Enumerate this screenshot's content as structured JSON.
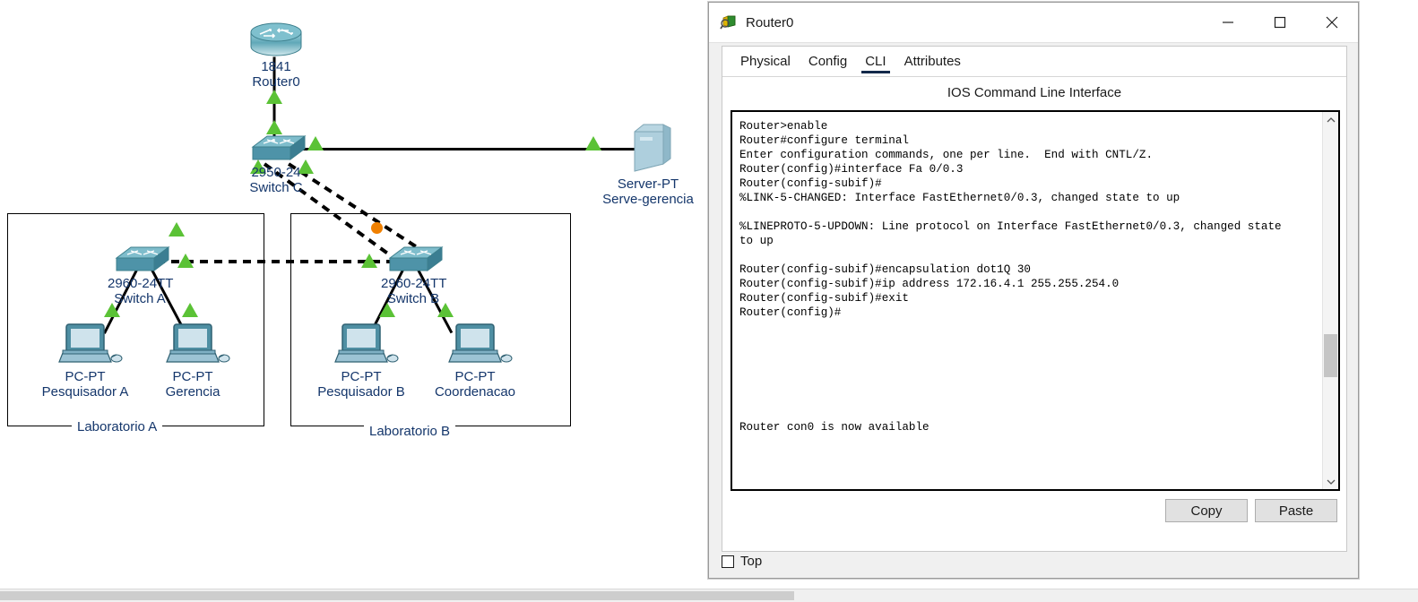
{
  "window": {
    "title": "Router0",
    "icon": "packet-tracer-device-icon",
    "controls": {
      "minimize": "minimize-icon",
      "maximize": "maximize-icon",
      "close": "close-icon"
    }
  },
  "tabs": [
    {
      "label": "Physical",
      "active": false
    },
    {
      "label": "Config",
      "active": false
    },
    {
      "label": "CLI",
      "active": true
    },
    {
      "label": "Attributes",
      "active": false
    }
  ],
  "cli": {
    "heading": "IOS Command Line Interface",
    "terminal_text": "Router>enable\nRouter#configure terminal\nEnter configuration commands, one per line.  End with CNTL/Z.\nRouter(config)#interface Fa 0/0.3\nRouter(config-subif)#\n%LINK-5-CHANGED: Interface FastEthernet0/0.3, changed state to up\n\n%LINEPROTO-5-UPDOWN: Line protocol on Interface FastEthernet0/0.3, changed state\nto up\n\nRouter(config-subif)#encapsulation dot1Q 30\nRouter(config-subif)#ip address 172.16.4.1 255.255.254.0\nRouter(config-subif)#exit\nRouter(config)#\n\n\n\n\n\n\n\nRouter con0 is now available",
    "scroll_up_icon": "chevron-up-icon",
    "scroll_down_icon": "chevron-down-icon"
  },
  "buttons": {
    "copy": "Copy",
    "paste": "Paste"
  },
  "top_option": {
    "label": "Top",
    "checked": false
  },
  "topology": {
    "accent_link_color": "#000000",
    "status_up_color": "#5bc236",
    "packet_color": "#f08000",
    "label_color": "#14366b",
    "devices": [
      {
        "id": "router0",
        "model": "1841",
        "name": "Router0",
        "type": "router"
      },
      {
        "id": "switchC",
        "model": "2950-24",
        "name": "Switch C",
        "type": "switch"
      },
      {
        "id": "switchA",
        "model": "2960-24TT",
        "name": "Switch A",
        "type": "switch"
      },
      {
        "id": "switchB",
        "model": "2960-24TT",
        "name": "Switch B",
        "type": "switch"
      },
      {
        "id": "server",
        "model": "Server-PT",
        "name": "Serve-gerencia",
        "type": "server"
      },
      {
        "id": "pcA1",
        "model": "PC-PT",
        "name": "Pesquisador A",
        "type": "pc"
      },
      {
        "id": "pcA2",
        "model": "PC-PT",
        "name": "Gerencia",
        "type": "pc"
      },
      {
        "id": "pcB1",
        "model": "PC-PT",
        "name": "Pesquisador B",
        "type": "pc"
      },
      {
        "id": "pcB2",
        "model": "PC-PT",
        "name": "Coordenacao",
        "type": "pc"
      }
    ],
    "groups": [
      {
        "id": "labA",
        "label": "Laboratorio A"
      },
      {
        "id": "labB",
        "label": "Laboratorio B"
      }
    ]
  }
}
